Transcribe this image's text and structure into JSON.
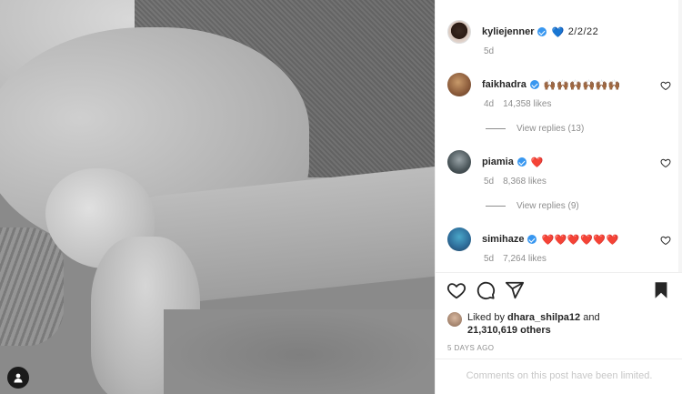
{
  "post": {
    "author": "kyliejenner",
    "caption_emoji": "💙",
    "caption": "2/2/22",
    "age": "5d",
    "likes_liker": "dhara_shilpa12",
    "likes_prefix": "Liked by",
    "likes_mid": "and",
    "likes_count": "21,310,619 others",
    "posted_ago": "5 DAYS AGO",
    "comments_notice": "Comments on this post have been limited."
  },
  "comments": [
    {
      "user": "faikhadra",
      "text": "🙌🏾🙌🏾🙌🏾🙌🏾🙌🏾🙌🏾",
      "age": "4d",
      "likes": "14,358 likes",
      "replies": "View replies (13)"
    },
    {
      "user": "piamia",
      "text": "❤️",
      "age": "5d",
      "likes": "8,368 likes",
      "replies": "View replies (9)"
    },
    {
      "user": "simihaze",
      "text": "❤️❤️❤️❤️❤️❤️",
      "age": "5d",
      "likes": "7,264 likes",
      "replies": ""
    }
  ],
  "colors": {
    "verified": "#3897f0",
    "heart": "#ed4956",
    "muted": "#8e8e8e"
  },
  "icons": [
    "verified-badge-icon",
    "heart-outline-icon",
    "comment-icon",
    "share-icon",
    "bookmark-icon",
    "user-tag-icon"
  ]
}
